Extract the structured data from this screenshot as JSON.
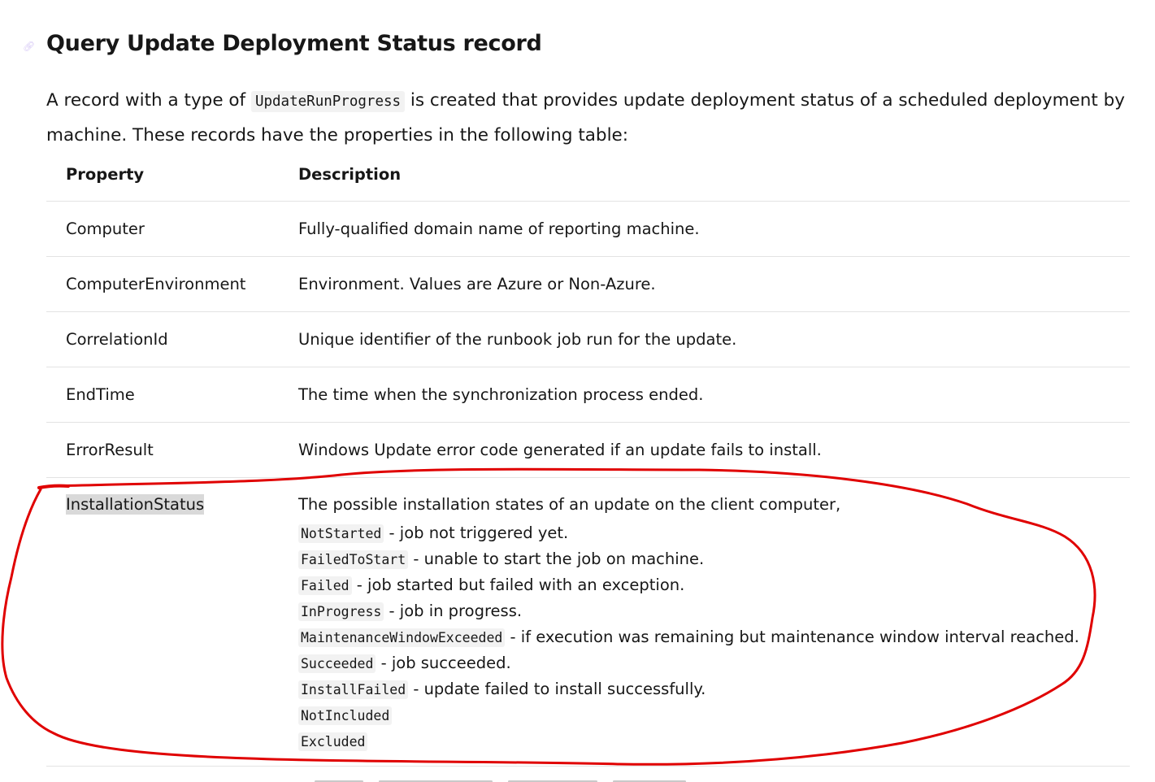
{
  "heading": {
    "anchor_icon": "link-anchor-icon",
    "title": "Query Update Deployment Status record"
  },
  "intro": {
    "prefix": "A record with a type of ",
    "code": "UpdateRunProgress",
    "suffix": " is created that provides update deployment status of a scheduled deployment by machine. These records have the properties in the following table:"
  },
  "table": {
    "headers": {
      "property": "Property",
      "description": "Description"
    },
    "rows": [
      {
        "property": "Computer",
        "description": "Fully-qualified domain name of reporting machine."
      },
      {
        "property": "ComputerEnvironment",
        "description": "Environment. Values are Azure or Non-Azure."
      },
      {
        "property": "CorrelationId",
        "description": "Unique identifier of the runbook job run for the update."
      },
      {
        "property": "EndTime",
        "description": "The time when the synchronization process ended."
      },
      {
        "property": "ErrorResult",
        "description": "Windows Update error code generated if an update fails to install."
      }
    ],
    "installation_status": {
      "property": "InstallationStatus",
      "lead": "The possible installation states of an update on the client computer,",
      "states": [
        {
          "code": "NotStarted",
          "text": " - job not triggered yet."
        },
        {
          "code": "FailedToStart",
          "text": " - unable to start the job on machine."
        },
        {
          "code": "Failed",
          "text": " - job started but failed with an exception."
        },
        {
          "code": "InProgress",
          "text": " - job in progress."
        },
        {
          "code": "MaintenanceWindowExceeded",
          "text": " - if execution was remaining but maintenance window interval reached."
        },
        {
          "code": "Succeeded",
          "text": " - job succeeded."
        },
        {
          "code": "InstallFailed",
          "text": " - update failed to install successfully."
        },
        {
          "code": "NotIncluded",
          "text": ""
        },
        {
          "code": "Excluded",
          "text": ""
        }
      ]
    }
  },
  "colors": {
    "annotation": "#e00000",
    "highlight": "#d9d9d9",
    "divider": "#e3e3e3",
    "code_background": "#f2f2f2",
    "text": "#171717"
  }
}
